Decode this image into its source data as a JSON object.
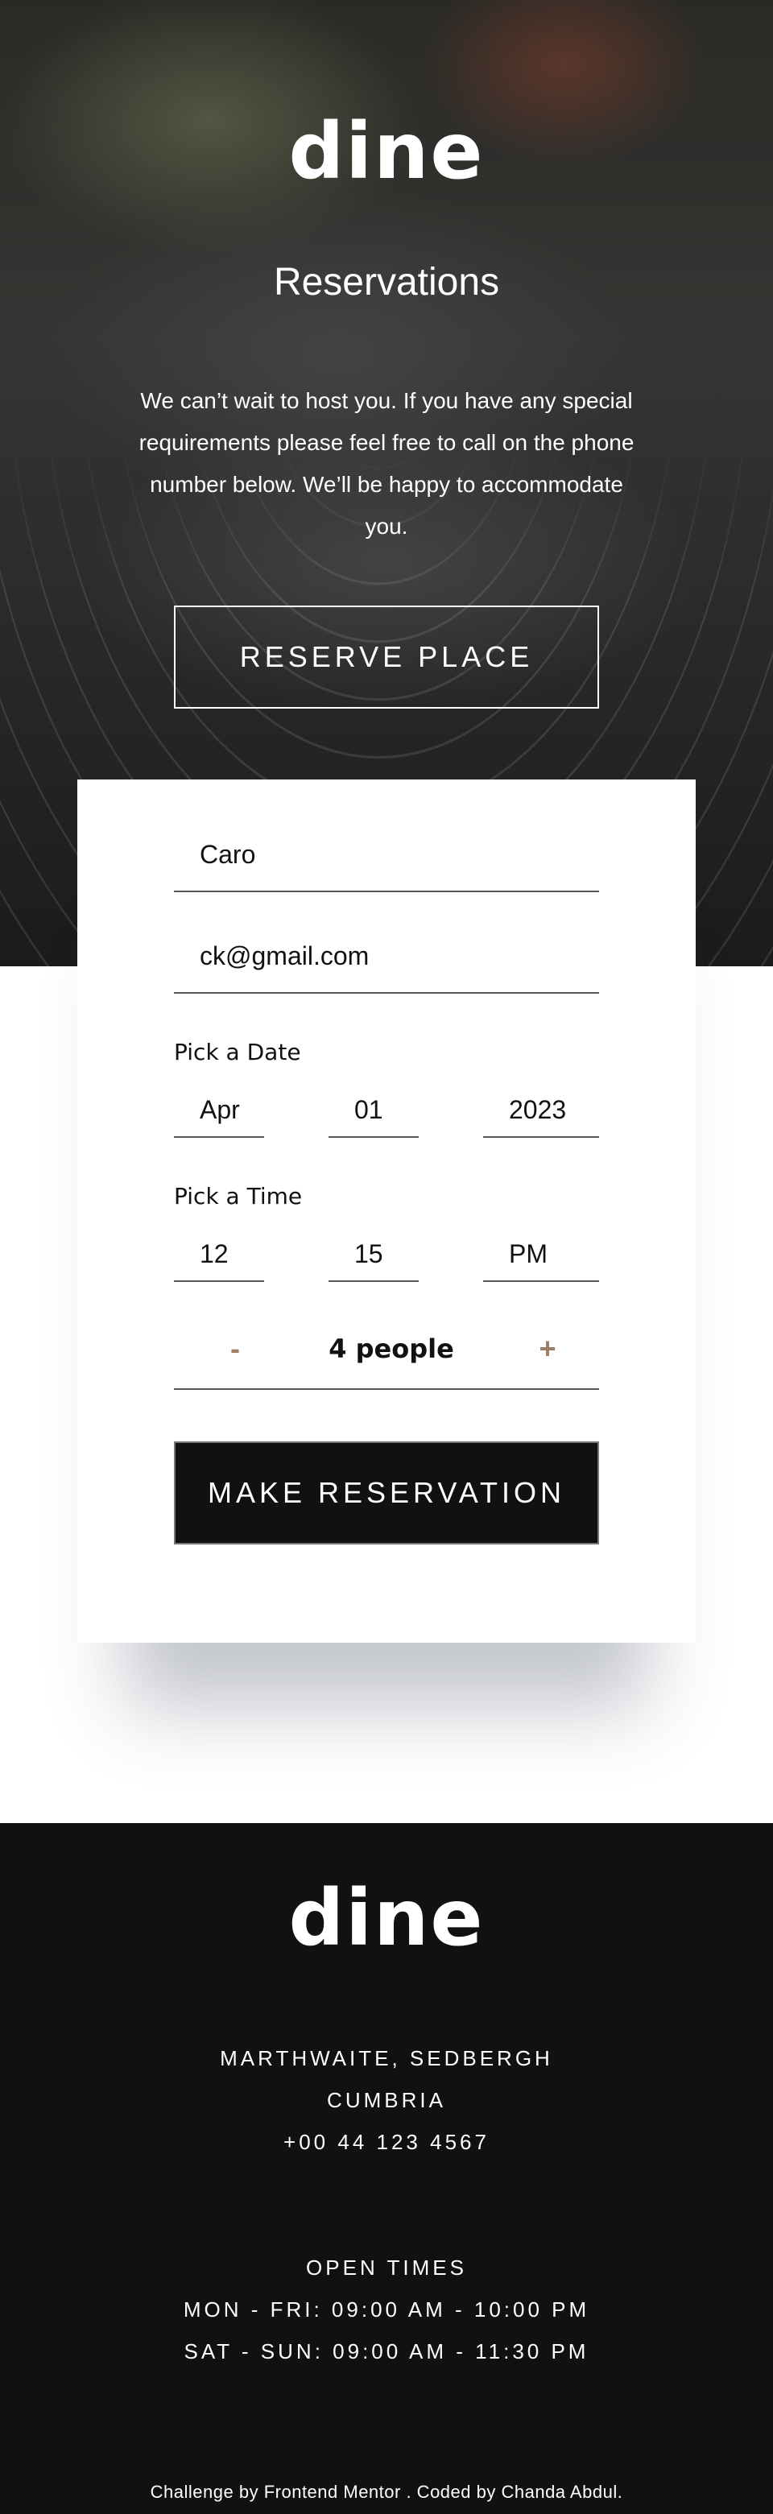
{
  "hero": {
    "logo": "dine",
    "title": "Reservations",
    "text": "We can’t wait to host you. If you have any special requirements please feel free to call on the phone number below. We’ll be happy to accommodate you.",
    "button_label": "RESERVE PLACE"
  },
  "form": {
    "name_value": "Caro",
    "email_value": "ck@gmail.com",
    "date_label": "Pick a Date",
    "date": {
      "month": "Apr",
      "day": "01",
      "year": "2023"
    },
    "time_label": "Pick a Time",
    "time": {
      "hour": "12",
      "minute": "15",
      "period": "PM"
    },
    "decrement_label": "-",
    "increment_label": "+",
    "people_label": "4 people",
    "submit_label": "MAKE RESERVATION"
  },
  "footer": {
    "logo": "dine",
    "address": [
      "MARTHWAITE, SEDBERGH",
      "CUMBRIA",
      "+00 44 123 4567"
    ],
    "hours_title": "OPEN TIMES",
    "hours": [
      "MON - FRI: 09:00 AM - 10:00 PM",
      "SAT - SUN: 09:00 AM - 11:30 PM"
    ],
    "credit": "Challenge by Frontend Mentor . Coded by Chanda Abdul."
  }
}
